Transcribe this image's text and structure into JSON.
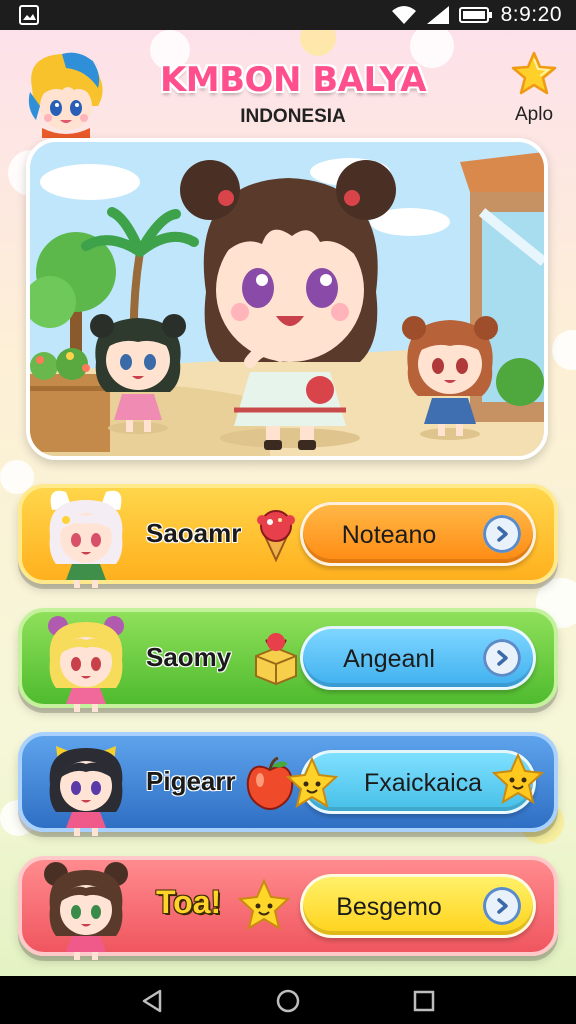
{
  "status_bar": {
    "time": "8:9:20",
    "icons": [
      "gallery-icon",
      "wifi-icon",
      "signal-icon",
      "battery-icon"
    ]
  },
  "header": {
    "title": "KMBON BALYA",
    "subtitle": "INDONESIA",
    "app_button_label": "Aplo",
    "app_button_icon": "star-icon"
  },
  "menu": [
    {
      "label": "Saoamr",
      "button": "Noteano",
      "deco": "ice-cream-icon",
      "color": "#ffc22e"
    },
    {
      "label": "Saomy",
      "button": "Angeanl",
      "deco": "gift-box-icon",
      "color": "#62c93a"
    },
    {
      "label": "Pigearr",
      "button": "Fxaickaica",
      "deco": "apple-icon",
      "color": "#3f82d6"
    },
    {
      "label": "Toa!",
      "button": "Besgemo",
      "deco": "star-icon",
      "color": "#f76a70"
    }
  ],
  "nav": {
    "icons": [
      "back-icon",
      "home-icon",
      "recents-icon"
    ]
  }
}
